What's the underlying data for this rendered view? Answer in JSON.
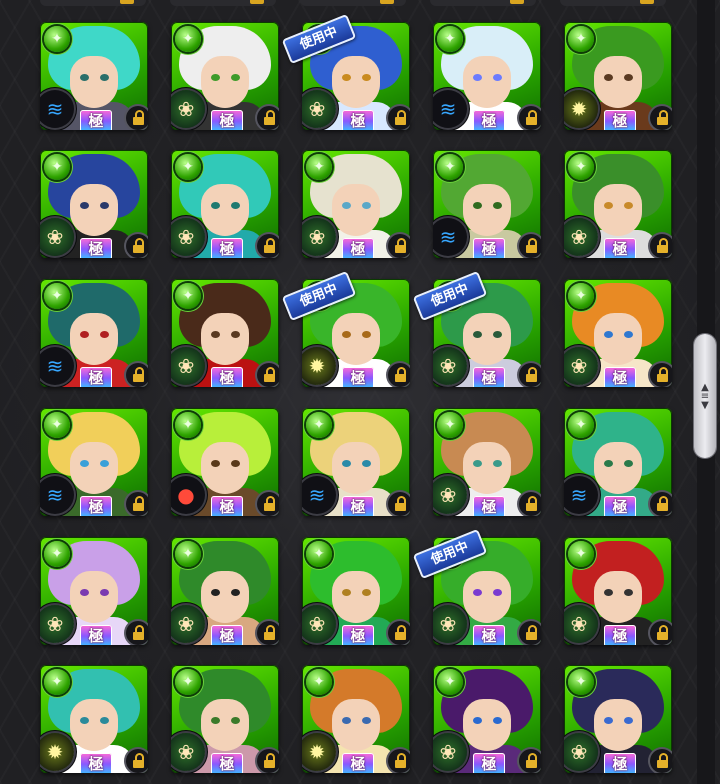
{
  "colors": {
    "card_green": "#29a600",
    "rank_gradient": [
      "#ff6bd5",
      "#8a58ff",
      "#35c7ff"
    ],
    "lock_gold": "#e5b12a",
    "inuse_blue": "#2a56c4"
  },
  "labels": {
    "rank": "極",
    "in_use": "使用中",
    "element_icon": "wood-element-icon",
    "lock_icon": "lock-icon"
  },
  "scrollbar": {
    "glyph_up": "▲",
    "glyph_grip": "≡",
    "glyph_down": "▼",
    "position": 0.5
  },
  "rows": [
    {
      "cards": [
        {
          "id": "r1c1",
          "skill": "wave",
          "rank": "極",
          "in_use": false,
          "hair": "#3fd8c8",
          "eyes": "#2a6f6a",
          "outfit": "#556"
        },
        {
          "id": "r1c2",
          "skill": "lotus",
          "rank": "極",
          "in_use": false,
          "hair": "#eeeeee",
          "eyes": "#3e9b2a",
          "outfit": "#333"
        },
        {
          "id": "r1c3",
          "skill": "lotus",
          "rank": "極",
          "in_use": true,
          "hair": "#2f5fd0",
          "eyes": "#c98a1e",
          "outfit": "#d8e8ff"
        },
        {
          "id": "r1c4",
          "skill": "wave",
          "rank": "極",
          "in_use": false,
          "hair": "#d9eef8",
          "eyes": "#6b7bff",
          "outfit": "#fff"
        },
        {
          "id": "r1c5",
          "skill": "gear",
          "rank": "極",
          "in_use": false,
          "hair": "#3a9a20",
          "eyes": "#5a3a22",
          "outfit": "#6a3a1c"
        }
      ]
    },
    {
      "cards": [
        {
          "id": "r2c1",
          "skill": "lotus",
          "rank": "極",
          "in_use": false,
          "hair": "#27459e",
          "eyes": "#2a3a6a",
          "outfit": "#222"
        },
        {
          "id": "r2c2",
          "skill": "lotus",
          "rank": "極",
          "in_use": false,
          "hair": "#31c9b8",
          "eyes": "#1e7a70",
          "outfit": "#2aa"
        },
        {
          "id": "r2c3",
          "skill": "lotus",
          "rank": "極",
          "in_use": false,
          "hair": "#e6e2cf",
          "eyes": "#5aa8c8",
          "outfit": "#f2f2e8"
        },
        {
          "id": "r2c4",
          "skill": "wave",
          "rank": "極",
          "in_use": false,
          "hair": "#52a833",
          "eyes": "#2f6b1f",
          "outfit": "#c9c9a0"
        },
        {
          "id": "r2c5",
          "skill": "lotus",
          "rank": "極",
          "in_use": false,
          "hair": "#3a8f2a",
          "eyes": "#c88a2a",
          "outfit": "#ddd"
        }
      ]
    },
    {
      "cards": [
        {
          "id": "r3c1",
          "skill": "wave",
          "rank": "極",
          "in_use": false,
          "hair": "#1f6a6a",
          "eyes": "#b02020",
          "outfit": "#c22"
        },
        {
          "id": "r3c2",
          "skill": "lotus",
          "rank": "極",
          "in_use": false,
          "hair": "#4a2a1a",
          "eyes": "#5a3a20",
          "outfit": "#b11"
        },
        {
          "id": "r3c3",
          "skill": "gear",
          "rank": "極",
          "in_use": true,
          "hair": "#39b52a",
          "eyes": "#a86a1a",
          "outfit": "#fff"
        },
        {
          "id": "r3c4",
          "skill": "lotus",
          "rank": "極",
          "in_use": true,
          "hair": "#2d9a4a",
          "eyes": "#2a5a3a",
          "outfit": "#ccd"
        },
        {
          "id": "r3c5",
          "skill": "lotus",
          "rank": "極",
          "in_use": false,
          "hair": "#e88a24",
          "eyes": "#2f78d0",
          "outfit": "#f6e6c8"
        }
      ]
    },
    {
      "cards": [
        {
          "id": "r4c1",
          "skill": "wave",
          "rank": "極",
          "in_use": false,
          "hair": "#f1cf5a",
          "eyes": "#3aa0d8",
          "outfit": "#3a6a2a"
        },
        {
          "id": "r4c2",
          "skill": "fruit",
          "rank": "極",
          "in_use": false,
          "hair": "#b8ef3a",
          "eyes": "#5a3a1a",
          "outfit": "#6a4a2a"
        },
        {
          "id": "r4c3",
          "skill": "wave",
          "rank": "極",
          "in_use": false,
          "hair": "#ecd27a",
          "eyes": "#2a8aa8",
          "outfit": "#e8e0c8"
        },
        {
          "id": "r4c4",
          "skill": "lotus",
          "rank": "極",
          "in_use": false,
          "hair": "#c88a52",
          "eyes": "#3a9a8a",
          "outfit": "#eee"
        },
        {
          "id": "r4c5",
          "skill": "wave",
          "rank": "極",
          "in_use": false,
          "hair": "#2fb38a",
          "eyes": "#2a7a4a",
          "outfit": "#3a8"
        }
      ]
    },
    {
      "cards": [
        {
          "id": "r5c1",
          "skill": "lotus",
          "rank": "極",
          "in_use": false,
          "hair": "#c9a0e8",
          "eyes": "#7a3ab0",
          "outfit": "#e7d7f7"
        },
        {
          "id": "r5c2",
          "skill": "lotus",
          "rank": "極",
          "in_use": false,
          "hair": "#2f8a2a",
          "eyes": "#222",
          "outfit": "#d8a880"
        },
        {
          "id": "r5c3",
          "skill": "lotus",
          "rank": "極",
          "in_use": false,
          "hair": "#2dbd2d",
          "eyes": "#b08020",
          "outfit": "#2a5"
        },
        {
          "id": "r5c4",
          "skill": "lotus",
          "rank": "極",
          "in_use": true,
          "hair": "#36ad2a",
          "eyes": "#7a3ad0",
          "outfit": "#3a4"
        },
        {
          "id": "r5c5",
          "skill": "lotus",
          "rank": "極",
          "in_use": false,
          "hair": "#c22020",
          "eyes": "#333",
          "outfit": "#222"
        }
      ]
    },
    {
      "cards": [
        {
          "id": "r6c1",
          "skill": "gear",
          "rank": "極",
          "in_use": false,
          "hair": "#32c0b0",
          "eyes": "#2a8a9a",
          "outfit": "#fff"
        },
        {
          "id": "r6c2",
          "skill": "lotus",
          "rank": "極",
          "in_use": false,
          "hair": "#2f8a2a",
          "eyes": "#3a7a2a",
          "outfit": "#c9a"
        },
        {
          "id": "r6c3",
          "skill": "gear",
          "rank": "極",
          "in_use": false,
          "hair": "#d47a2a",
          "eyes": "#3a6ab0",
          "outfit": "#f4e4b0"
        },
        {
          "id": "r6c4",
          "skill": "lotus",
          "rank": "極",
          "in_use": false,
          "hair": "#4a1a6a",
          "eyes": "#2a6ad0",
          "outfit": "#5a2a7a"
        },
        {
          "id": "r6c5",
          "skill": "lotus",
          "rank": "極",
          "in_use": false,
          "hair": "#2a2a5a",
          "eyes": "#3a6ad0",
          "outfit": "#223"
        }
      ]
    }
  ]
}
